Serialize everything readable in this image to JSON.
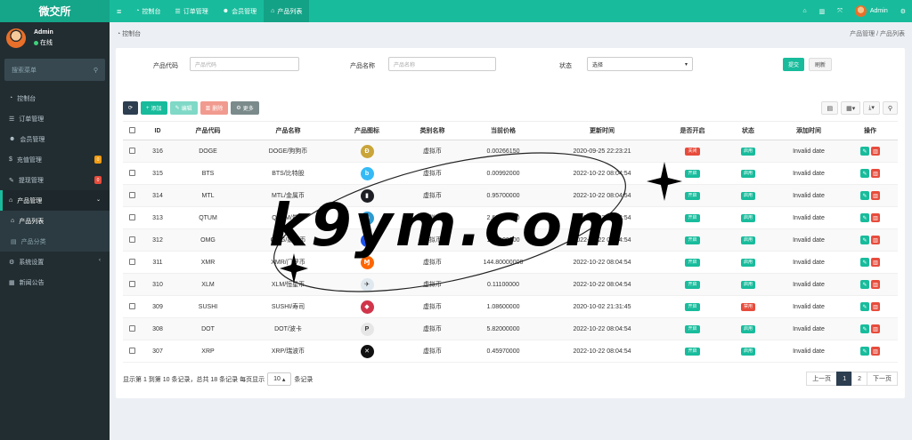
{
  "brand": "微交所",
  "topnav": [
    {
      "icon": "menu-icon",
      "label": ""
    },
    {
      "icon": "dashboard-icon",
      "label": "控制台"
    },
    {
      "icon": "list-icon",
      "label": "订单管理"
    },
    {
      "icon": "users-icon",
      "label": "会员管理"
    },
    {
      "icon": "shop-icon",
      "label": "产品列表"
    }
  ],
  "user": {
    "name": "Admin",
    "status": "在线"
  },
  "sidebar": {
    "search_placeholder": "搜索菜单",
    "items": [
      {
        "label": "控制台"
      },
      {
        "label": "订单管理"
      },
      {
        "label": "会员管理"
      },
      {
        "label": "充值管理",
        "badge": "0"
      },
      {
        "label": "提现管理",
        "badge": "0"
      },
      {
        "label": "产品管理"
      },
      {
        "label": "产品列表"
      },
      {
        "label": "产品分类"
      },
      {
        "label": "系统设置"
      },
      {
        "label": "新闻公告"
      }
    ]
  },
  "breadcrumb": {
    "left": "控制台",
    "right1": "产品管理",
    "sep": "/",
    "right2": "产品列表"
  },
  "filter": {
    "code_label": "产品代码",
    "code_placeholder": "产品代码",
    "name_label": "产品名称",
    "name_placeholder": "产品名称",
    "status_label": "状态",
    "status_value": "选择",
    "submit": "提交",
    "reset": "刷新"
  },
  "toolbar": {
    "add": "添加",
    "edit": "编辑",
    "delete": "删除",
    "more": "更多"
  },
  "table": {
    "headers": [
      "ID",
      "产品代码",
      "产品名称",
      "产品图标",
      "类别名称",
      "当前价格",
      "更新时间",
      "是否开启",
      "状态",
      "添加时间",
      "操作"
    ],
    "rows": [
      {
        "id": "316",
        "code": "DOGE",
        "name": "DOGE/狗狗币",
        "cat": "虚拟币",
        "price": "0.00266150",
        "time": "2020-09-25 22:23:21",
        "open": "关闭",
        "open_color": "#e74c3c",
        "status": "启用",
        "status_color": "#18bc9c",
        "added": "Invalid date",
        "icon_bg": "#c9a53a"
      },
      {
        "id": "315",
        "code": "BTS",
        "name": "BTS/比特股",
        "cat": "虚拟币",
        "price": "0.00992000",
        "time": "2022-10-22 08:04:54",
        "open": "开启",
        "open_color": "#18bc9c",
        "status": "启用",
        "status_color": "#18bc9c",
        "added": "Invalid date",
        "icon_bg": "#35baf6"
      },
      {
        "id": "314",
        "code": "MTL",
        "name": "MTL/金属币",
        "cat": "虚拟币",
        "price": "0.95700000",
        "time": "2022-10-22 08:04:54",
        "open": "开启",
        "open_color": "#18bc9c",
        "status": "启用",
        "status_color": "#18bc9c",
        "added": "Invalid date",
        "icon_bg": "#1e1f25"
      },
      {
        "id": "313",
        "code": "QTUM",
        "name": "QTUM/量子",
        "cat": "虚拟币",
        "price": "2.62300000",
        "time": "2022-10-22 08:04:54",
        "open": "开启",
        "open_color": "#18bc9c",
        "status": "启用",
        "status_color": "#18bc9c",
        "added": "Invalid date",
        "icon_bg": "#2e9ad0"
      },
      {
        "id": "312",
        "code": "OMG",
        "name": "OMG/嫩模币",
        "cat": "虚拟币",
        "price": "1.58100000",
        "time": "2022-10-22 08:04:54",
        "open": "开启",
        "open_color": "#18bc9c",
        "status": "启用",
        "status_color": "#18bc9c",
        "added": "Invalid date",
        "icon_bg": "#1a53f0"
      },
      {
        "id": "311",
        "code": "XMR",
        "name": "XMR/门罗币",
        "cat": "虚拟币",
        "price": "144.80000000",
        "time": "2022-10-22 08:04:54",
        "open": "开启",
        "open_color": "#18bc9c",
        "status": "启用",
        "status_color": "#18bc9c",
        "added": "Invalid date",
        "icon_bg": "#ff6600"
      },
      {
        "id": "310",
        "code": "XLM",
        "name": "XLM/恒星币",
        "cat": "虚拟币",
        "price": "0.11100000",
        "time": "2022-10-22 08:04:54",
        "open": "开启",
        "open_color": "#18bc9c",
        "status": "启用",
        "status_color": "#18bc9c",
        "added": "Invalid date",
        "icon_bg": "#dfe8ee"
      },
      {
        "id": "309",
        "code": "SUSHI",
        "name": "SUSHI/寿司",
        "cat": "虚拟币",
        "price": "1.08600000",
        "time": "2020-10-02 21:31:45",
        "open": "开启",
        "open_color": "#18bc9c",
        "status": "禁用",
        "status_color": "#e74c3c",
        "added": "Invalid date",
        "icon_bg": "#d0354a"
      },
      {
        "id": "308",
        "code": "DOT",
        "name": "DOT/波卡",
        "cat": "虚拟币",
        "price": "5.82000000",
        "time": "2022-10-22 08:04:54",
        "open": "开启",
        "open_color": "#18bc9c",
        "status": "启用",
        "status_color": "#18bc9c",
        "added": "Invalid date",
        "icon_bg": "#e6e6e6"
      },
      {
        "id": "307",
        "code": "XRP",
        "name": "XRP/瑞波币",
        "cat": "虚拟币",
        "price": "0.45970000",
        "time": "2022-10-22 08:04:54",
        "open": "开启",
        "open_color": "#18bc9c",
        "status": "启用",
        "status_color": "#18bc9c",
        "added": "Invalid date",
        "icon_bg": "#111111"
      }
    ]
  },
  "pager": {
    "info_prefix": "显示第 1 到第 10 条记录，总共 18 条记录 每页显示",
    "page_size": "10",
    "info_suffix": "条记录",
    "prev": "上一页",
    "p1": "1",
    "p2": "2",
    "next": "下一页"
  },
  "watermark": "k9ym.com",
  "colors": {
    "accent": "#18bc9c",
    "sidebar": "#222d32",
    "danger": "#e74c3c"
  }
}
